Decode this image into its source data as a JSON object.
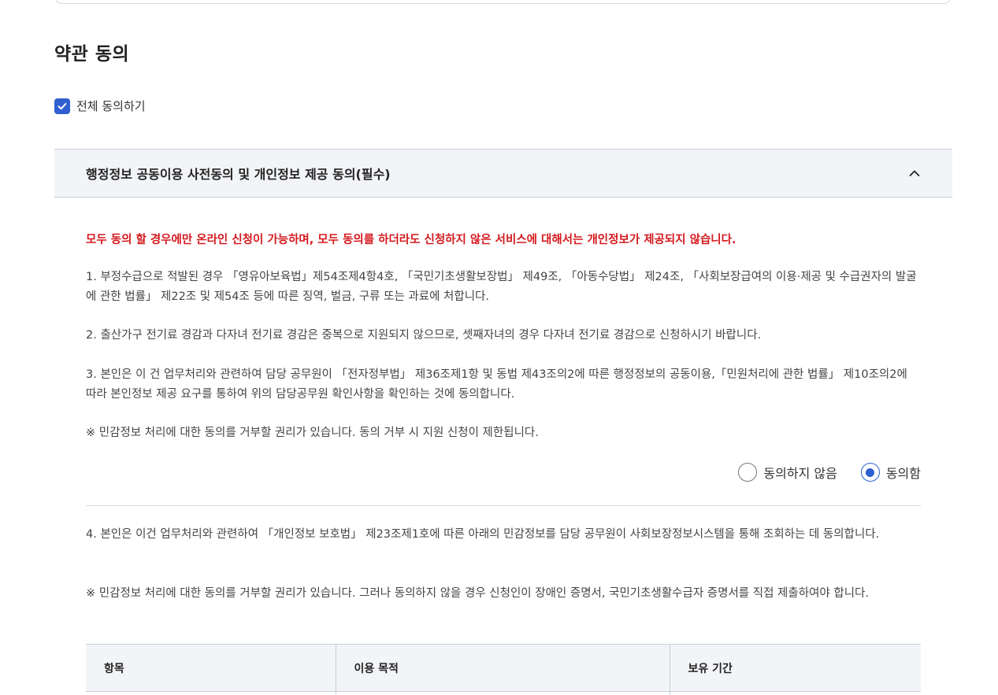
{
  "section_title": "약관 동의",
  "agree_all": {
    "label": "전체 동의하기",
    "checked": true
  },
  "accordion": {
    "title": "행정정보 공동이용 사전동의 및 개인정보 제공 동의(필수)",
    "expanded": true
  },
  "content": {
    "warning": "모두 동의 할 경우에만 온라인 신청이 가능하며, 모두 동의를 하더라도 신청하지 않은 서비스에 대해서는 개인정보가 제공되지 않습니다.",
    "item1": "1. 부정수급으로 적발된 경우 「영유아보육법」제54조제4항4호, 「국민기초생활보장법」 제49조, 「아동수당법」 제24조, 「사회보장급여의 이용·제공 및 수급권자의 발굴에 관한 법률」 제22조 및 제54조 등에 따른 징역, 벌금, 구류 또는 과료에 처합니다.",
    "item2": "2. 출산가구 전기료 경감과 다자녀 전기료 경감은 중복으로 지원되지 않으므로, 셋째자녀의 경우 다자녀 전기료 경감으로 신청하시기 바랍니다.",
    "item3": "3. 본인은 이 건 업무처리와 관련하여 담당 공무원이 「전자정부법」 제36조제1항 및 동법 제43조의2에 따른 행정정보의 공동이용,「민원처리에 관한 법률」 제10조의2에 따라 본인정보 제공 요구를 통하여 위의 담당공무원 확인사항을 확인하는 것에 동의합니다.",
    "note1": "※ 민감정보 처리에 대한 동의를 거부할 권리가 있습니다. 동의 거부 시 지원 신청이 제한됩니다.",
    "radio_disagree": "동의하지 않음",
    "radio_agree": "동의함",
    "selected": "agree",
    "item4": "4. 본인은 이건 업무처리와 관련하여 「개인정보 보호법」 제23조제1호에 따른 아래의 민감정보를 담당 공무원이 사회보장정보시스템을 통해 조회하는 데 동의합니다.",
    "note2": "※ 민감정보 처리에 대한 동의를 거부할 권리가 있습니다. 그러나 동의하지 않을 경우 신청인이 장애인 증명서, 국민기초생활수급자 증명서를 직접 제출하여야 합니다."
  },
  "table": {
    "headers": [
      "항목",
      "이용 목적",
      "보유 기간"
    ]
  },
  "colors": {
    "accent": "#2f5fd0",
    "warning": "#d4191e",
    "header_bg": "#f2f4f7"
  },
  "icons": {
    "checkbox": "check-icon",
    "accordion_toggle": "chevron-up-icon"
  }
}
